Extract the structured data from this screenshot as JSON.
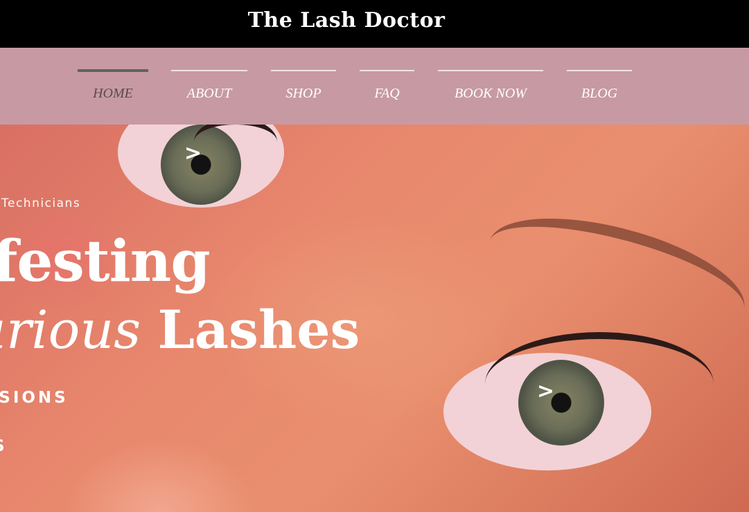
{
  "header": {
    "site_title": "The Lash Doctor"
  },
  "nav": {
    "items": [
      {
        "label": "HOME",
        "active": true
      },
      {
        "label": "ABOUT",
        "active": false
      },
      {
        "label": "SHOP",
        "active": false
      },
      {
        "label": "FAQ",
        "active": false
      },
      {
        "label": "BOOK NOW",
        "active": false
      },
      {
        "label": "BLOG",
        "active": false
      }
    ]
  },
  "hero": {
    "tagline": "Technicians",
    "headline_line1": "ifesting",
    "headline_line2_italic": "urious",
    "headline_line2_bold": "Lashes",
    "subline1": "NSIONS",
    "subline2": "S",
    "slider_arrows": [
      ">",
      ">"
    ]
  },
  "colors": {
    "nav_background": "#c79aa3",
    "header_background": "#000000",
    "active_indicator": "#5e6262"
  }
}
